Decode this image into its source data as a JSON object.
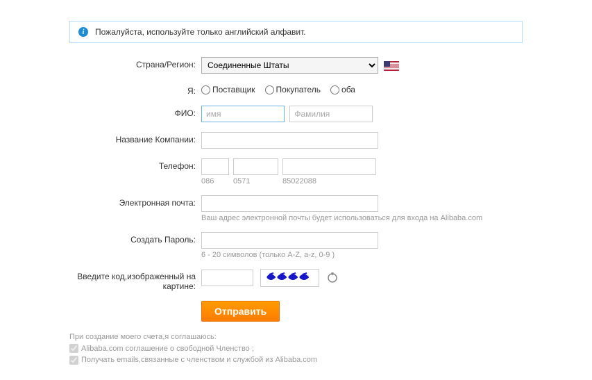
{
  "banner": {
    "text": "Пожалуйста, используйте только английский алфавит."
  },
  "labels": {
    "country": "Страна/Регион:",
    "iam": "Я:",
    "fio": "ФИО:",
    "company": "Название Компании:",
    "phone": "Телефон:",
    "email": "Электронная почта:",
    "password": "Создать Пароль:",
    "captcha": "Введите код,изображенный на картине:"
  },
  "country": {
    "selected": "Соединенные Штаты"
  },
  "role_options": {
    "supplier": "Поставщик",
    "buyer": "Покупатель",
    "both": "оба"
  },
  "fio": {
    "first_placeholder": "имя",
    "last_placeholder": "Фамилия"
  },
  "phone_hints": {
    "h1": "086",
    "h2": "0571",
    "h3": "85022088"
  },
  "email_hint": "Ваш адрес электронной почты будет использоваться для входа на Alibaba.com",
  "password_hint": "6 - 20 символов (только A-Z, a-z, 0-9 )",
  "submit_label": "Отправить",
  "agreement": {
    "intro": "При создание моего счета,я соглашаюсь:",
    "line1": "Alibaba.com соглашение о свободной Членство ;",
    "line2": "Получать emails,связанные с членством и службой из Alibaba.com"
  }
}
